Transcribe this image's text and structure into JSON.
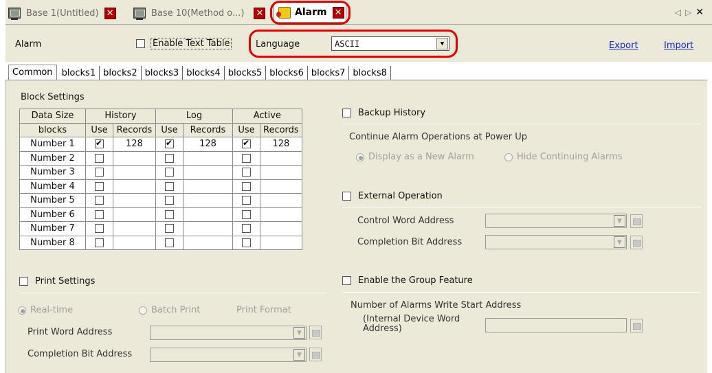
{
  "doc_tabs": [
    {
      "label": "Base 1(Untitled)",
      "icon": "screen-icon"
    },
    {
      "label": "Base 10(Method o...)",
      "icon": "screen-icon"
    },
    {
      "label": "Alarm",
      "icon": "alarm-icon",
      "active": true
    }
  ],
  "header": {
    "title": "Alarm",
    "enable_text_table": {
      "label": "Enable Text Table",
      "checked": false
    },
    "language_label": "Language",
    "language_value": "ASCII",
    "export_label": "Export",
    "import_label": "Import"
  },
  "tabs": [
    "Common",
    "blocks1",
    "blocks2",
    "blocks3",
    "blocks4",
    "blocks5",
    "blocks6",
    "blocks7",
    "blocks8"
  ],
  "block_settings": {
    "title": "Block Settings",
    "col_headers": [
      "Data Size",
      "History",
      "Log",
      "Active"
    ],
    "sub_headers": [
      "blocks",
      "Use",
      "Records",
      "Use",
      "Records",
      "Use",
      "Records"
    ],
    "rows": [
      {
        "name": "Number 1",
        "history_use": true,
        "history_records": "128",
        "log_use": true,
        "log_records": "128",
        "active_use": true,
        "active_records": "128"
      },
      {
        "name": "Number 2",
        "history_use": false,
        "history_records": "",
        "log_use": false,
        "log_records": "",
        "active_use": false,
        "active_records": ""
      },
      {
        "name": "Number 3",
        "history_use": false,
        "history_records": "",
        "log_use": false,
        "log_records": "",
        "active_use": false,
        "active_records": ""
      },
      {
        "name": "Number 4",
        "history_use": false,
        "history_records": "",
        "log_use": false,
        "log_records": "",
        "active_use": false,
        "active_records": ""
      },
      {
        "name": "Number 5",
        "history_use": false,
        "history_records": "",
        "log_use": false,
        "log_records": "",
        "active_use": false,
        "active_records": ""
      },
      {
        "name": "Number 6",
        "history_use": false,
        "history_records": "",
        "log_use": false,
        "log_records": "",
        "active_use": false,
        "active_records": ""
      },
      {
        "name": "Number 7",
        "history_use": false,
        "history_records": "",
        "log_use": false,
        "log_records": "",
        "active_use": false,
        "active_records": ""
      },
      {
        "name": "Number 8",
        "history_use": false,
        "history_records": "",
        "log_use": false,
        "log_records": "",
        "active_use": false,
        "active_records": ""
      }
    ]
  },
  "print": {
    "label": "Print Settings",
    "realtime": "Real-time",
    "batch": "Batch Print",
    "format": "Print Format",
    "word_address": "Print Word Address",
    "completion_bit": "Completion Bit Address"
  },
  "backup": {
    "label": "Backup History",
    "continue": "Continue Alarm Operations at Power Up",
    "display_new": "Display as a New Alarm",
    "hide_continuing": "Hide Continuing Alarms"
  },
  "external": {
    "label": "External Operation",
    "control_word": "Control Word Address",
    "completion_bit": "Completion Bit Address"
  },
  "group": {
    "label": "Enable the Group Feature",
    "write_start": "Number of Alarms Write Start Address",
    "internal_word": "(Internal Device Word\nAddress)"
  },
  "colors": {
    "highlight": "#e20000",
    "link": "#0a28c8",
    "close_button": "#b40000"
  }
}
